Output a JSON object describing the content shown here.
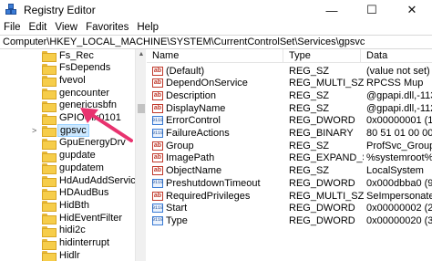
{
  "window": {
    "title": "Registry Editor",
    "minimize": "—",
    "maximize": "☐",
    "close": "✕"
  },
  "menu": [
    "File",
    "Edit",
    "View",
    "Favorites",
    "Help"
  ],
  "address": "Computer\\HKEY_LOCAL_MACHINE\\SYSTEM\\CurrentControlSet\\Services\\gpsvc",
  "tree": [
    {
      "label": "Fs_Rec",
      "chevron": ""
    },
    {
      "label": "FsDepends",
      "chevron": ""
    },
    {
      "label": "fvevol",
      "chevron": ""
    },
    {
      "label": "gencounter",
      "chevron": ""
    },
    {
      "label": "genericusbfn",
      "chevron": ""
    },
    {
      "label": "GPIOClx0101",
      "chevron": ""
    },
    {
      "label": "gpsvc",
      "chevron": ">",
      "selected": true
    },
    {
      "label": "GpuEnergyDrv",
      "chevron": ""
    },
    {
      "label": "gupdate",
      "chevron": ""
    },
    {
      "label": "gupdatem",
      "chevron": ""
    },
    {
      "label": "HdAudAddService",
      "chevron": ""
    },
    {
      "label": "HDAudBus",
      "chevron": ""
    },
    {
      "label": "HidBth",
      "chevron": ""
    },
    {
      "label": "HidEventFilter",
      "chevron": ""
    },
    {
      "label": "hidi2c",
      "chevron": ""
    },
    {
      "label": "hidinterrupt",
      "chevron": ""
    },
    {
      "label": "Hidlr",
      "chevron": ""
    }
  ],
  "columns": {
    "name": "Name",
    "type": "Type",
    "data": "Data"
  },
  "values": [
    {
      "icon": "ab",
      "name": "(Default)",
      "type": "REG_SZ",
      "data": "(value not set)"
    },
    {
      "icon": "ab",
      "name": "DependOnService",
      "type": "REG_MULTI_SZ",
      "data": "RPCSS Mup"
    },
    {
      "icon": "ab",
      "name": "Description",
      "type": "REG_SZ",
      "data": "@gpapi.dll,-113"
    },
    {
      "icon": "ab",
      "name": "DisplayName",
      "type": "REG_SZ",
      "data": "@gpapi.dll,-112"
    },
    {
      "icon": "bin",
      "name": "ErrorControl",
      "type": "REG_DWORD",
      "data": "0x00000001 (1)"
    },
    {
      "icon": "bin",
      "name": "FailureActions",
      "type": "REG_BINARY",
      "data": "80 51 01 00 00 00"
    },
    {
      "icon": "ab",
      "name": "Group",
      "type": "REG_SZ",
      "data": "ProfSvc_Group"
    },
    {
      "icon": "ab",
      "name": "ImagePath",
      "type": "REG_EXPAND_SZ",
      "data": "%systemroot%\\sys"
    },
    {
      "icon": "ab",
      "name": "ObjectName",
      "type": "REG_SZ",
      "data": "LocalSystem"
    },
    {
      "icon": "bin",
      "name": "PreshutdownTimeout",
      "type": "REG_DWORD",
      "data": "0x000dbba0 (9000"
    },
    {
      "icon": "ab",
      "name": "RequiredPrivileges",
      "type": "REG_MULTI_SZ",
      "data": "SeImpersonatePr"
    },
    {
      "icon": "bin",
      "name": "Start",
      "type": "REG_DWORD",
      "data": "0x00000002 (2)"
    },
    {
      "icon": "bin",
      "name": "Type",
      "type": "REG_DWORD",
      "data": "0x00000020 (32)"
    }
  ],
  "colors": {
    "arrow": "#e8336f",
    "selection": "#cce8ff",
    "folder": "#f6cd4a"
  }
}
